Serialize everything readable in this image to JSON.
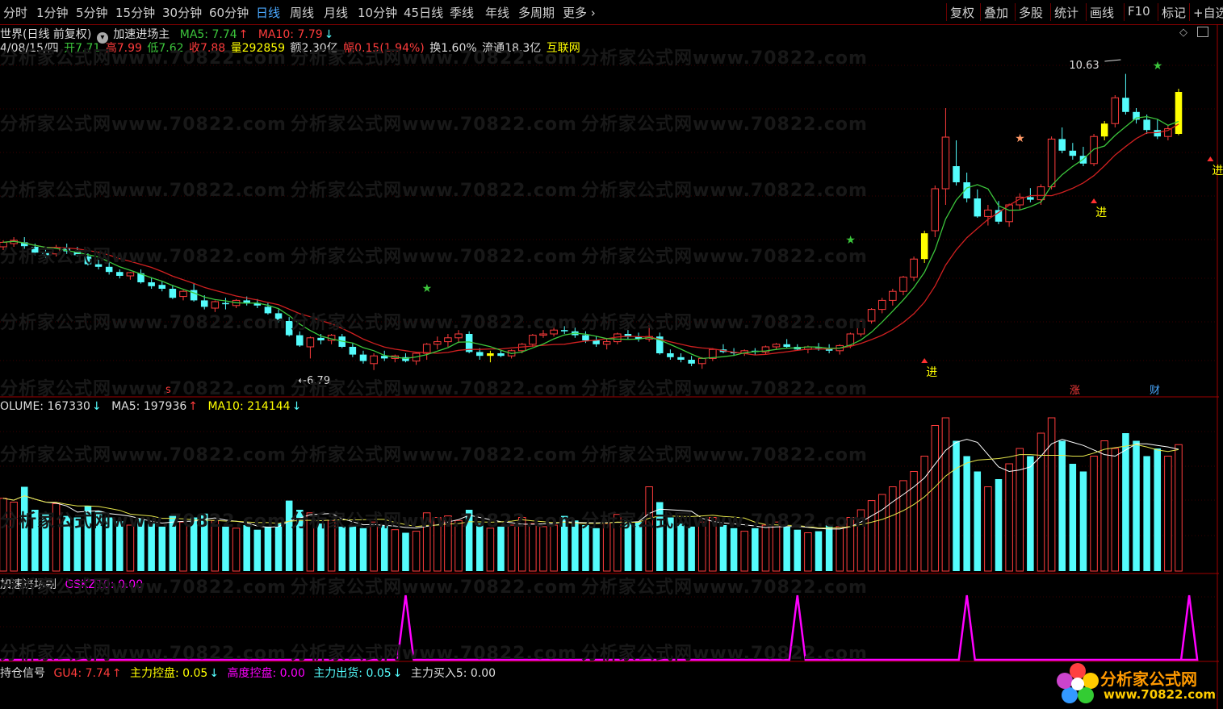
{
  "toolbar": {
    "tabs": [
      "分时",
      "1分钟",
      "5分钟",
      "15分钟",
      "30分钟",
      "60分钟",
      "日线",
      "周线",
      "月线",
      "10分钟",
      "45日线",
      "季线",
      "年线",
      "多周期",
      "更多"
    ],
    "active": "日线",
    "right": [
      "复权",
      "叠加",
      "多股",
      "统计",
      "画线",
      "F10",
      "标记",
      "+自选"
    ]
  },
  "header": {
    "stock": "世界(日线 前复权)",
    "indicator": "加速进场主",
    "ma5": "MA5: 7.74",
    "ma10": "MA10: 7.79",
    "date": "4/08/15/四",
    "open": "开7.71",
    "high": "高7.99",
    "low": "低7.62",
    "close": "收7.88",
    "vol": "量292859",
    "amount": "额2.30亿",
    "change": "幅0.15(1.94%)",
    "turnover": "换1.60%",
    "float": "流通18.3亿",
    "sector": "互联网"
  },
  "price_labels": {
    "high": "10.63",
    "low": "6.79",
    "jin": "进",
    "zhang": "涨",
    "cai": "财",
    "s": "s"
  },
  "volume": {
    "label": "OLUME: 167330",
    "ma5": "MA5: 197936",
    "ma10": "MA10: 214144"
  },
  "sub1": {
    "name": "加速进场副",
    "value": "GSKZ10: 0.00"
  },
  "sub2": {
    "name": "持仓信号",
    "gu4": "GU4: 7.74",
    "ctrl": "主力控盘: 0.05",
    "high_ctrl": "高度控盘: 0.00",
    "out": "主力出货: 0.05",
    "buy": "主力买入5: 0.00"
  },
  "watermark": "分析家公式网www.70822.com",
  "logo": {
    "title": "分析家公式网",
    "url": "www.70822.com"
  },
  "colors": {
    "up": "#ff3c3c",
    "down": "#54fcfc",
    "ma5": "#3cc63c",
    "ma10": "#d02020",
    "yellow": "#ffff00",
    "magenta": "#ff00ff",
    "grid": "#7a0000"
  },
  "candles": [
    [
      7.95,
      8.05,
      7.9,
      8.02
    ],
    [
      8.0,
      8.1,
      7.95,
      8.05
    ],
    [
      8.02,
      8.1,
      7.92,
      7.96
    ],
    [
      7.95,
      8.0,
      7.82,
      7.86
    ],
    [
      7.86,
      7.92,
      7.78,
      7.82
    ],
    [
      7.84,
      7.98,
      7.8,
      7.94
    ],
    [
      7.92,
      8.0,
      7.84,
      7.88
    ],
    [
      7.88,
      7.95,
      7.8,
      7.82
    ],
    [
      7.8,
      7.85,
      7.66,
      7.68
    ],
    [
      7.68,
      7.75,
      7.6,
      7.64
    ],
    [
      7.64,
      7.72,
      7.52,
      7.56
    ],
    [
      7.56,
      7.6,
      7.46,
      7.5
    ],
    [
      7.5,
      7.56,
      7.44,
      7.55
    ],
    [
      7.54,
      7.6,
      7.38,
      7.4
    ],
    [
      7.4,
      7.48,
      7.3,
      7.34
    ],
    [
      7.36,
      7.42,
      7.26,
      7.3
    ],
    [
      7.3,
      7.36,
      7.14,
      7.16
    ],
    [
      7.18,
      7.28,
      7.12,
      7.26
    ],
    [
      7.28,
      7.38,
      7.1,
      7.12
    ],
    [
      7.12,
      7.2,
      6.98,
      7.02
    ],
    [
      7.0,
      7.12,
      6.94,
      7.1
    ],
    [
      7.08,
      7.16,
      6.98,
      7.06
    ],
    [
      7.04,
      7.14,
      7.0,
      7.12
    ],
    [
      7.12,
      7.18,
      7.04,
      7.08
    ],
    [
      7.08,
      7.14,
      7.0,
      7.04
    ],
    [
      7.02,
      7.08,
      6.9,
      6.92
    ],
    [
      6.92,
      6.98,
      6.78,
      6.8
    ],
    [
      6.8,
      6.86,
      6.56,
      6.58
    ],
    [
      6.58,
      6.64,
      6.4,
      6.42
    ],
    [
      6.4,
      6.56,
      6.22,
      6.54
    ],
    [
      6.54,
      6.6,
      6.44,
      6.5
    ],
    [
      6.5,
      6.6,
      6.44,
      6.58
    ],
    [
      6.56,
      6.6,
      6.38,
      6.4
    ],
    [
      6.4,
      6.46,
      6.24,
      6.28
    ],
    [
      6.28,
      6.34,
      6.14,
      6.18
    ],
    [
      6.14,
      6.3,
      6.04,
      6.26
    ],
    [
      6.26,
      6.34,
      6.18,
      6.22
    ],
    [
      6.22,
      6.28,
      6.16,
      6.26
    ],
    [
      6.24,
      6.3,
      6.16,
      6.18
    ],
    [
      6.18,
      6.32,
      6.12,
      6.3
    ],
    [
      6.3,
      6.46,
      6.2,
      6.44
    ],
    [
      6.44,
      6.56,
      6.36,
      6.48
    ],
    [
      6.48,
      6.6,
      6.4,
      6.54
    ],
    [
      6.54,
      6.66,
      6.46,
      6.6
    ],
    [
      6.6,
      6.64,
      6.3,
      6.32
    ],
    [
      6.32,
      6.38,
      6.2,
      6.26
    ],
    [
      6.26,
      6.34,
      6.16,
      6.3
    ],
    [
      6.3,
      6.34,
      6.24,
      6.26
    ],
    [
      6.26,
      6.36,
      6.22,
      6.34
    ],
    [
      6.34,
      6.46,
      6.3,
      6.44
    ],
    [
      6.44,
      6.6,
      6.4,
      6.58
    ],
    [
      6.58,
      6.66,
      6.54,
      6.6
    ],
    [
      6.6,
      6.7,
      6.56,
      6.66
    ],
    [
      6.66,
      6.72,
      6.6,
      6.64
    ],
    [
      6.64,
      6.7,
      6.54,
      6.58
    ],
    [
      6.58,
      6.64,
      6.46,
      6.5
    ],
    [
      6.5,
      6.56,
      6.4,
      6.44
    ],
    [
      6.44,
      6.52,
      6.36,
      6.48
    ],
    [
      6.48,
      6.62,
      6.44,
      6.6
    ],
    [
      6.6,
      6.66,
      6.52,
      6.56
    ],
    [
      6.56,
      6.62,
      6.48,
      6.52
    ],
    [
      6.52,
      6.76,
      6.48,
      6.56
    ],
    [
      6.56,
      6.62,
      6.28,
      6.3
    ],
    [
      6.3,
      6.36,
      6.2,
      6.24
    ],
    [
      6.24,
      6.3,
      6.16,
      6.2
    ],
    [
      6.2,
      6.26,
      6.1,
      6.14
    ],
    [
      6.14,
      6.24,
      6.06,
      6.22
    ],
    [
      6.22,
      6.38,
      6.18,
      6.36
    ],
    [
      6.36,
      6.44,
      6.3,
      6.32
    ],
    [
      6.32,
      6.38,
      6.26,
      6.3
    ],
    [
      6.3,
      6.36,
      6.26,
      6.34
    ],
    [
      6.34,
      6.38,
      6.28,
      6.32
    ],
    [
      6.32,
      6.42,
      6.28,
      6.4
    ],
    [
      6.4,
      6.46,
      6.36,
      6.44
    ],
    [
      6.44,
      6.52,
      6.38,
      6.4
    ],
    [
      6.4,
      6.44,
      6.34,
      6.36
    ],
    [
      6.36,
      6.42,
      6.3,
      6.4
    ],
    [
      6.4,
      6.46,
      6.34,
      6.38
    ],
    [
      6.38,
      6.44,
      6.3,
      6.34
    ],
    [
      6.34,
      6.44,
      6.28,
      6.42
    ],
    [
      6.42,
      6.62,
      6.38,
      6.6
    ],
    [
      6.6,
      6.82,
      6.56,
      6.8
    ],
    [
      6.8,
      7.0,
      6.76,
      6.98
    ],
    [
      6.98,
      7.16,
      6.92,
      7.12
    ],
    [
      7.12,
      7.3,
      7.04,
      7.26
    ],
    [
      7.26,
      7.5,
      7.2,
      7.48
    ],
    [
      7.48,
      7.8,
      7.42,
      7.76
    ],
    [
      7.76,
      8.2,
      7.7,
      8.16
    ],
    [
      8.2,
      8.9,
      8.1,
      8.85
    ],
    [
      8.85,
      10.1,
      8.6,
      9.65
    ],
    [
      9.2,
      9.6,
      8.9,
      8.95
    ],
    [
      8.95,
      9.1,
      8.64,
      8.7
    ],
    [
      8.7,
      8.84,
      8.4,
      8.42
    ],
    [
      8.42,
      8.6,
      8.28,
      8.52
    ],
    [
      8.52,
      8.66,
      8.3,
      8.34
    ],
    [
      8.34,
      8.62,
      8.26,
      8.6
    ],
    [
      8.6,
      8.78,
      8.52,
      8.72
    ],
    [
      8.72,
      8.86,
      8.64,
      8.68
    ],
    [
      8.68,
      8.92,
      8.6,
      8.88
    ],
    [
      8.88,
      9.66,
      8.84,
      9.62
    ],
    [
      9.62,
      9.8,
      9.4,
      9.44
    ],
    [
      9.44,
      9.56,
      9.3,
      9.36
    ],
    [
      9.36,
      9.5,
      9.2,
      9.24
    ],
    [
      9.24,
      9.7,
      9.2,
      9.66
    ],
    [
      9.66,
      9.9,
      9.6,
      9.86
    ],
    [
      9.86,
      10.3,
      9.8,
      10.26
    ],
    [
      10.26,
      10.63,
      10.0,
      10.04
    ],
    [
      10.04,
      10.1,
      9.86,
      9.92
    ],
    [
      9.92,
      10.0,
      9.7,
      9.76
    ],
    [
      9.76,
      9.92,
      9.62,
      9.66
    ],
    [
      9.66,
      9.84,
      9.6,
      9.78
    ],
    [
      9.7,
      10.4,
      9.68,
      10.35
    ]
  ],
  "volumes": [
    95,
    90,
    110,
    80,
    75,
    88,
    72,
    70,
    85,
    78,
    70,
    65,
    60,
    68,
    62,
    58,
    72,
    64,
    70,
    75,
    66,
    58,
    56,
    60,
    54,
    58,
    62,
    92,
    80,
    76,
    62,
    66,
    58,
    60,
    56,
    64,
    60,
    54,
    50,
    52,
    76,
    70,
    72,
    66,
    80,
    62,
    56,
    58,
    60,
    70,
    62,
    58,
    60,
    72,
    66,
    60,
    56,
    62,
    74,
    66,
    64,
    110,
    90,
    70,
    62,
    58,
    64,
    70,
    60,
    56,
    52,
    56,
    60,
    64,
    58,
    54,
    50,
    52,
    60,
    58,
    70,
    80,
    92,
    100,
    110,
    118,
    130,
    150,
    190,
    200,
    170,
    150,
    130,
    110,
    120,
    140,
    160,
    150,
    180,
    200,
    170,
    140,
    130,
    150,
    170,
    160,
    180,
    170,
    150,
    160,
    150,
    165
  ],
  "sub_spikes": [
    38,
    75,
    91,
    112
  ]
}
